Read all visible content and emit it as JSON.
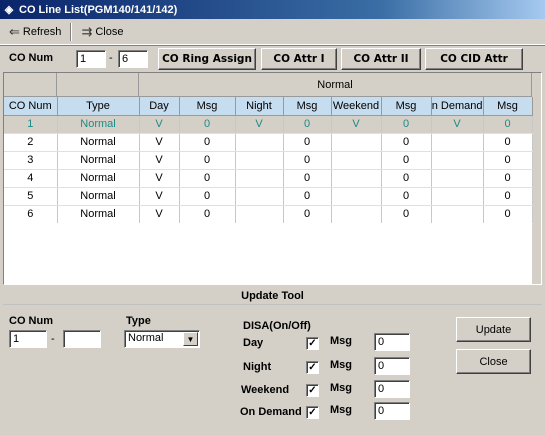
{
  "window": {
    "title": "CO Line List(PGM140/141/142)"
  },
  "toolbar": {
    "refresh_label": "Refresh",
    "close_label": "Close"
  },
  "filter": {
    "label": "CO Num",
    "from_value": "1",
    "dash": "-",
    "to_value": "6",
    "buttons": [
      "CO Ring Assign",
      "CO Attr I",
      "CO Attr II",
      "CO CID Attr"
    ]
  },
  "grid": {
    "group_header": "Normal",
    "columns": [
      "CO Num",
      "Type",
      "Day",
      "Msg",
      "Night",
      "Msg",
      "Weekend",
      "Msg",
      "On Demand",
      "Msg"
    ],
    "rows": [
      [
        "1",
        "Normal",
        "V",
        "0",
        "V",
        "0",
        "V",
        "0",
        "V",
        "0"
      ],
      [
        "2",
        "Normal",
        "V",
        "0",
        "",
        "0",
        "",
        "0",
        "",
        "0"
      ],
      [
        "3",
        "Normal",
        "V",
        "0",
        "",
        "0",
        "",
        "0",
        "",
        "0"
      ],
      [
        "4",
        "Normal",
        "V",
        "0",
        "",
        "0",
        "",
        "0",
        "",
        "0"
      ],
      [
        "5",
        "Normal",
        "V",
        "0",
        "",
        "0",
        "",
        "0",
        "",
        "0"
      ],
      [
        "6",
        "Normal",
        "V",
        "0",
        "",
        "0",
        "",
        "0",
        "",
        "0"
      ]
    ],
    "selected_row": 0,
    "selected_color": "#1e8a86"
  },
  "update_tool": {
    "title": "Update Tool",
    "co_num_label": "CO Num",
    "co_from": "1",
    "dash": "-",
    "co_to": "",
    "type_label": "Type",
    "type_value": "Normal",
    "disa_label": "DISA(On/Off)",
    "disa_rows": [
      {
        "label": "Day",
        "checked": true,
        "msg_label": "Msg",
        "msg_value": "0"
      },
      {
        "label": "Night",
        "checked": true,
        "msg_label": "Msg",
        "msg_value": "0"
      },
      {
        "label": "Weekend",
        "checked": true,
        "msg_label": "Msg",
        "msg_value": "0"
      },
      {
        "label": "On Demand",
        "checked": true,
        "msg_label": "Msg",
        "msg_value": "0"
      }
    ],
    "update_button": "Update",
    "close_button": "Close"
  }
}
